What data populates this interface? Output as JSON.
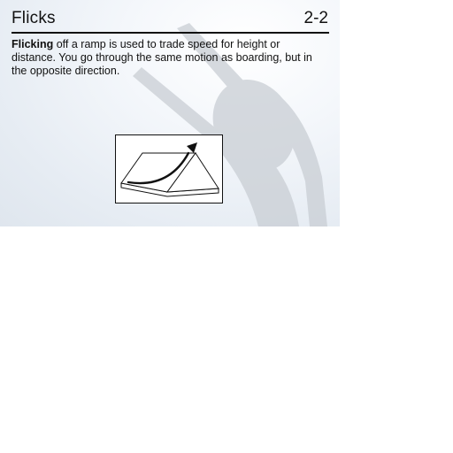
{
  "card": {
    "title": "Flicks",
    "page_number": "2-2",
    "body": {
      "emphasis": "Flicking",
      "text": " off a ramp is used to trade speed for height or distance. You go through the same motion as boarding, but in the opposite direction."
    }
  },
  "icons": {
    "background": "skier-silhouette-icon",
    "diagram": "ramp-flick-diagram"
  },
  "colors": {
    "text": "#111111",
    "background_light": "#f4f7fb",
    "background_shade": "#dfe6ee",
    "silhouette": "#c9ced4"
  }
}
